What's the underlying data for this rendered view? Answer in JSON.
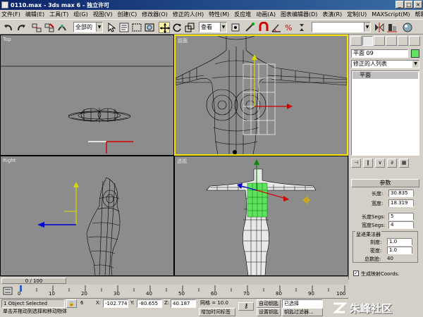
{
  "window": {
    "title": "0110.max - 3ds max 6 - 独立许可",
    "minimize": "_",
    "maximize": "□",
    "close": "×"
  },
  "menu": [
    "文件(F)",
    "编辑(E)",
    "工具(T)",
    "组(G)",
    "视图(V)",
    "创建(C)",
    "修改器(O)",
    "修正的人(H)",
    "特性(M)",
    "反应堆",
    "动画(A)",
    "图表编辑器(D)",
    "表演(R)",
    "定制(U)",
    "MAXScript(M)",
    "帮助(H)"
  ],
  "toolbar": {
    "selection_filter": "全部的",
    "reference_coord": "查看",
    "named_selection": ""
  },
  "viewports": {
    "top": "Top",
    "front": "前面",
    "left": "Right",
    "perspective": "透视"
  },
  "command_panel": {
    "object_name": "平面 09",
    "object_color": "#5fe35f",
    "modifier_list": "修正的人列表",
    "stack_item": "平面",
    "rollout_title": "参数",
    "length_label": "长度:",
    "length_value": "30.835",
    "width_label": "宽度:",
    "width_value": "18.319",
    "length_segs_label": "长度Segs:",
    "length_segs_value": "5",
    "width_segs_label": "宽度Segs:",
    "width_segs_value": "4",
    "render_group_title": "呈递乘法器",
    "scale_label": "刻度:",
    "scale_value": "1.0",
    "density_label": "密度:",
    "density_value": "1.0",
    "total_faces_label": "总数脸:",
    "total_faces_value": "40",
    "gen_mapping_label": "生成映射Coords."
  },
  "timeline": {
    "frame_display": "0 / 100",
    "ticks": [
      "0",
      "10",
      "20",
      "30",
      "40",
      "50",
      "60",
      "70",
      "80",
      "90",
      "100"
    ]
  },
  "status": {
    "selection": "1 Object Selected",
    "prompt": "单击并拖动到选择和移动物体",
    "lock_number": "6",
    "x_label": "X:",
    "x_value": "-102.774",
    "y_label": "Y:",
    "y_value": "-80.655",
    "z_label": "Z:",
    "z_value": "40.187",
    "grid_label": "网格 = 10.0",
    "add_time_tag": "增加时间标签",
    "autokey": "自动钥匙",
    "selected_dropdown": "已选择",
    "set_key": "设置钥匙",
    "key_filters": "钥匙过滤器..."
  },
  "watermark": "朱峰社区"
}
